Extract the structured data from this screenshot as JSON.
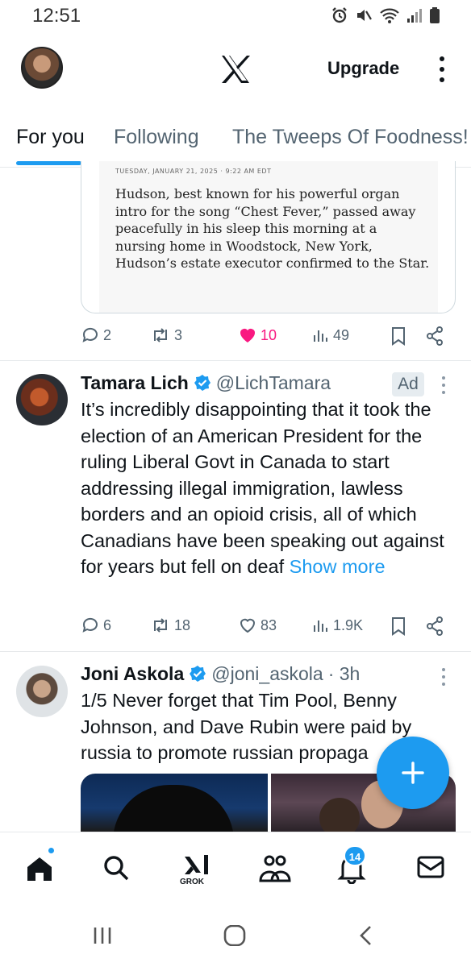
{
  "status_bar": {
    "time": "12:51"
  },
  "header": {
    "upgrade_label": "Upgrade"
  },
  "tabs": [
    {
      "label": "For you",
      "active": true
    },
    {
      "label": "Following",
      "active": false
    },
    {
      "label": "The Tweeps Of Foodness!",
      "active": false
    }
  ],
  "article": {
    "dateline": "TUESDAY, JANUARY 21, 2025 · 9:22 AM EDT",
    "text": "Hudson, best known for his powerful organ intro for the song “Chest Fever,” passed away peacefully in his sleep this morning at a nursing home in Woodstock, New York, Hudson’s estate executor confirmed to the Star."
  },
  "post1_actions": {
    "replies": "2",
    "reposts": "3",
    "likes": "10",
    "views": "49"
  },
  "post2": {
    "name": "Tamara Lich",
    "handle": "@LichTamara",
    "badge": "Ad",
    "text": "It’s incredibly disappointing that it took the election of an American President for the ruling Liberal Govt in Canada to start addressing illegal immigration, lawless borders and an opioid crisis, all of which Canadians have been speaking out against for years but fell on deaf ",
    "show_more": "Show more",
    "actions": {
      "replies": "6",
      "reposts": "18",
      "likes": "83",
      "views": "1.9K"
    }
  },
  "post3": {
    "name": "Joni Askola",
    "handle": "@joni_askola",
    "time": "· 3h",
    "text": "1/5 Never forget that Tim Pool, Benny Johnson, and Dave Rubin were paid by russia to promote russian propaga"
  },
  "bottom_nav": {
    "grok_label": "GROK",
    "notifications_count": "14"
  },
  "colors": {
    "accent": "#1d9bf0",
    "like": "#f91880",
    "muted": "#536471"
  }
}
